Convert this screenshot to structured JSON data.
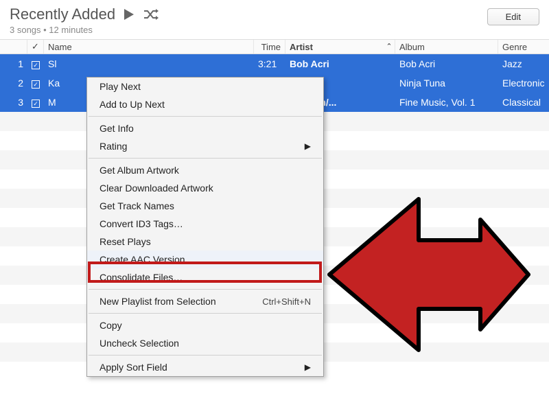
{
  "header": {
    "title": "Recently Added",
    "subtitle": "3 songs • 12 minutes",
    "edit_label": "Edit"
  },
  "columns": {
    "check": "✓",
    "name": "Name",
    "time": "Time",
    "artist": "Artist",
    "album": "Album",
    "genre": "Genre"
  },
  "rows": [
    {
      "num": "1",
      "name": "Sl",
      "time": "3:21",
      "artist": "Bob Acri",
      "album": "Bob Acri",
      "genre": "Jazz"
    },
    {
      "num": "2",
      "name": "Ka",
      "time": "",
      "artist": "",
      "album": "Ninja Tuna",
      "genre": "Electronic"
    },
    {
      "num": "3",
      "name": "M",
      "time": "",
      "artist": "oltzman/...",
      "album": "Fine Music, Vol. 1",
      "genre": "Classical"
    }
  ],
  "menu": {
    "play_next": "Play Next",
    "add_up_next": "Add to Up Next",
    "get_info": "Get Info",
    "rating": "Rating",
    "get_album_artwork": "Get Album Artwork",
    "clear_downloaded_artwork": "Clear Downloaded Artwork",
    "get_track_names": "Get Track Names",
    "convert_id3": "Convert ID3 Tags…",
    "reset_plays": "Reset Plays",
    "create_aac": "Create AAC Version",
    "consolidate": "Consolidate Files…",
    "new_playlist": "New Playlist from Selection",
    "new_playlist_shortcut": "Ctrl+Shift+N",
    "copy": "Copy",
    "uncheck": "Uncheck Selection",
    "apply_sort": "Apply Sort Field"
  }
}
